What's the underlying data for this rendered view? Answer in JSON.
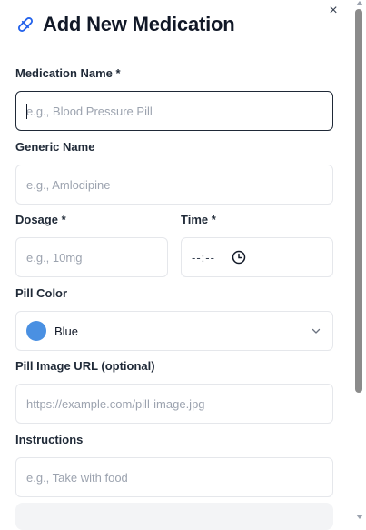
{
  "dialog": {
    "title": "Add New Medication",
    "title_icon": "pill-icon",
    "close_label": "×"
  },
  "form": {
    "medication_name": {
      "label": "Medication Name *",
      "placeholder": "e.g., Blood Pressure Pill",
      "value": ""
    },
    "generic_name": {
      "label": "Generic Name",
      "placeholder": "e.g., Amlodipine",
      "value": ""
    },
    "dosage": {
      "label": "Dosage *",
      "placeholder": "e.g., 10mg",
      "value": ""
    },
    "time": {
      "label": "Time *",
      "display": "--:--",
      "icon": "clock-icon"
    },
    "pill_color": {
      "label": "Pill Color",
      "selected": "Blue",
      "swatch_color": "#4a90e2",
      "icon": "chevron-down-icon"
    },
    "pill_image_url": {
      "label": "Pill Image URL (optional)",
      "placeholder": "https://example.com/pill-image.jpg",
      "value": ""
    },
    "instructions": {
      "label": "Instructions",
      "placeholder": "e.g., Take with food",
      "value": ""
    }
  },
  "colors": {
    "accent": "#2563eb",
    "focus_border": "#1f2937",
    "border": "#e5e7eb",
    "placeholder": "#9ca3af"
  }
}
